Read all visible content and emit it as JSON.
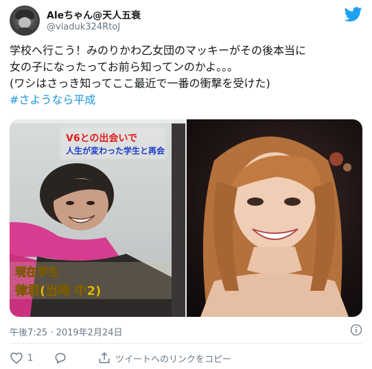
{
  "tweet": {
    "author_name": "Aleちゃん@天人五衰",
    "author_handle": "@viaduk324RtoJ",
    "text_lines": [
      "学校へ行こう！みのりかわ乙女団のマッキーがその後本当に",
      "女の子になったってお前ら知ってンのかよ。。。",
      "(ワシはさっき知ってここ最近で一番の衝撃を受けた)"
    ],
    "hashtag": "#さようなら平成",
    "timestamp": "午後7:25 · 2019年2月24日",
    "like_count": "1",
    "share_label": "ツイートへのリンクをコピー"
  },
  "media": {
    "left_caption_top_1": "V6との出会いで",
    "left_caption_top_2": "人生が変わった学生と再会",
    "left_caption_bottom_1": "現在学生",
    "left_caption_bottom_2": "律君(当時 中2)"
  },
  "colors": {
    "accent": "#1da1f2",
    "hashtag": "#1b95e0",
    "meta": "#657786",
    "like": "#e0245e"
  }
}
